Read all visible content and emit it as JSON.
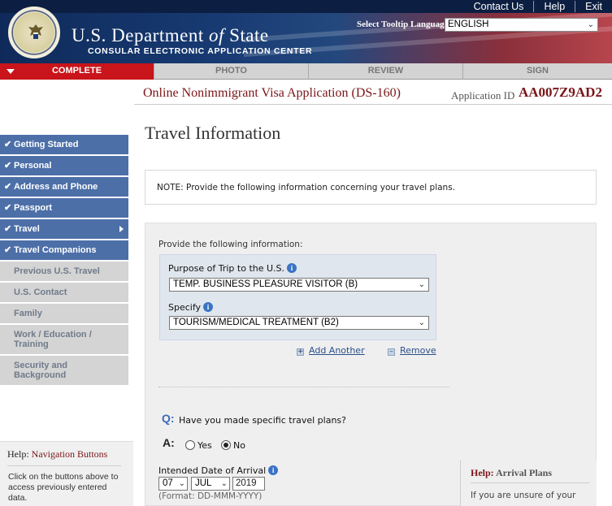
{
  "header": {
    "links": [
      "Contact Us",
      "Help",
      "Exit"
    ],
    "title_part1": "U.S. Department",
    "title_part2": "of",
    "title_part3": "State",
    "subtitle": "CONSULAR ELECTRONIC APPLICATION CENTER",
    "tooltip_label": "Select Tooltip Language",
    "language_value": "ENGLISH",
    "colors": {
      "navy": "#0f2a5a",
      "red": "#c8141a",
      "maroon": "#7a1518"
    }
  },
  "tabs": [
    {
      "label": "COMPLETE",
      "active": true
    },
    {
      "label": "PHOTO",
      "active": false
    },
    {
      "label": "REVIEW",
      "active": false
    },
    {
      "label": "SIGN",
      "active": false
    }
  ],
  "application": {
    "title": "Online Nonimmigrant Visa Application (DS-160)",
    "id_label": "Application ID",
    "id_value": "AA007Z9AD2"
  },
  "page_title": "Travel Information",
  "sidebar": {
    "items": [
      {
        "label": "Getting Started",
        "done": true
      },
      {
        "label": "Personal",
        "done": true
      },
      {
        "label": "Address and Phone",
        "done": true
      },
      {
        "label": "Passport",
        "done": true
      },
      {
        "label": "Travel",
        "done": true,
        "current": true
      },
      {
        "label": "Travel Companions",
        "done": true
      },
      {
        "label": "Previous U.S. Travel",
        "done": false
      },
      {
        "label": "U.S. Contact",
        "done": false
      },
      {
        "label": "Family",
        "done": false
      },
      {
        "label": "Work / Education / Training",
        "done": false
      },
      {
        "label": "Security and Background",
        "done": false
      }
    ],
    "help_title_prefix": "Help:",
    "help_title": "Navigation Buttons",
    "help_text": "Click on the buttons above to access previously entered data."
  },
  "note": "NOTE: Provide the following information concerning your travel plans.",
  "form": {
    "provide_text": "Provide the following information:",
    "purpose_label": "Purpose of Trip to the U.S.",
    "purpose_value": "TEMP. BUSINESS PLEASURE VISITOR (B)",
    "specify_label": "Specify",
    "specify_value": "TOURISM/MEDICAL TREATMENT (B2)",
    "add_label": "Add Another",
    "remove_label": "Remove",
    "question_prefix": "Q:",
    "question": "Have you made specific travel plans?",
    "answer_prefix": "A:",
    "yes_label": "Yes",
    "no_label": "No",
    "selected_answer": "No",
    "arrival_label": "Intended Date of Arrival",
    "arrival_day": "07",
    "arrival_month": "JUL",
    "arrival_year": "2019",
    "format_hint": "(Format: DD-MMM-YYYY)"
  },
  "arrival_help": {
    "title_prefix": "Help:",
    "title": "Arrival Plans",
    "text": "If you are unsure of your"
  }
}
